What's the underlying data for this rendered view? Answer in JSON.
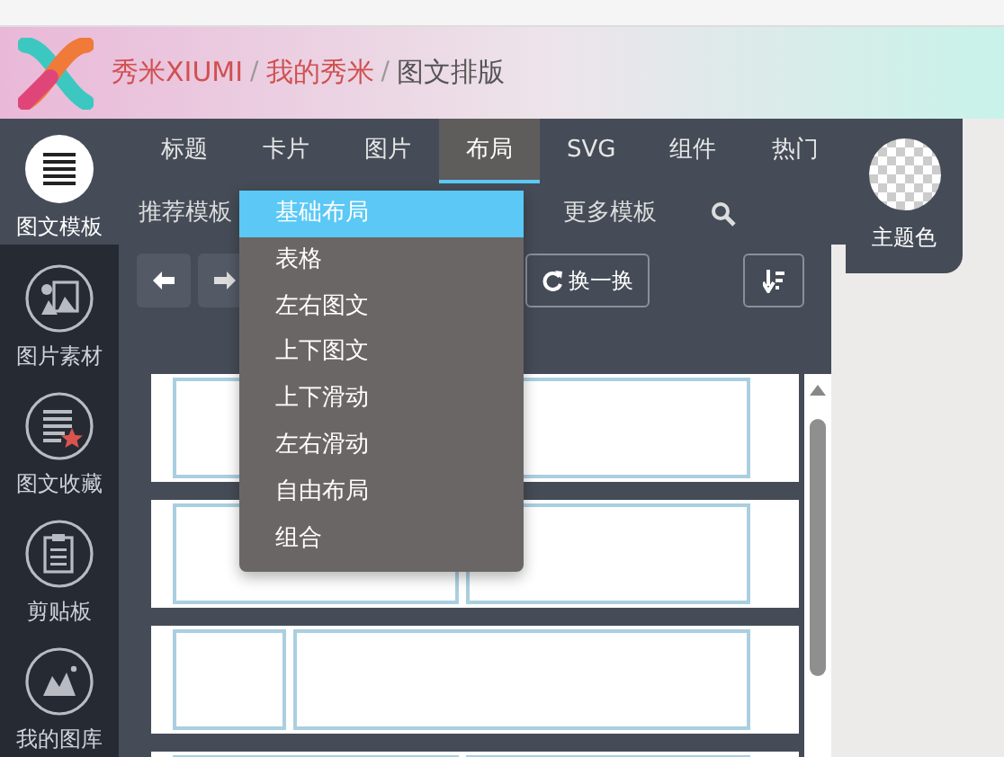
{
  "breadcrumbs": [
    {
      "label": "秀米XIUMI",
      "selected": false,
      "separator": "/"
    },
    {
      "label": "我的秀米",
      "selected": false,
      "separator": "/"
    },
    {
      "label": "图文排版",
      "selected": true
    }
  ],
  "sidebar": {
    "items": [
      {
        "label": "图文模板",
        "selected": true,
        "kind": "lines"
      },
      {
        "label": "图片素材",
        "selected": false,
        "kind": "photos"
      },
      {
        "label": "图文收藏",
        "selected": false,
        "kind": "favorite"
      },
      {
        "label": "剪贴板",
        "selected": false,
        "kind": "clipboard"
      },
      {
        "label": "我的图库",
        "selected": false,
        "kind": "gallery"
      }
    ]
  },
  "tabs": [
    {
      "label": "标题",
      "selected": false
    },
    {
      "label": "卡片",
      "selected": false
    },
    {
      "label": "图片",
      "selected": false
    },
    {
      "label": "布局",
      "selected": true
    },
    {
      "label": "SVG",
      "selected": false
    },
    {
      "label": "组件",
      "selected": false
    },
    {
      "label": "热门",
      "selected": false
    }
  ],
  "subtabs": [
    {
      "label": "推荐模板"
    },
    {
      "label": "更多模板"
    }
  ],
  "theme": {
    "label": "主题色"
  },
  "toolbar": {
    "shuffle_label": "换一换"
  },
  "dropdown": [
    {
      "label": "基础布局",
      "selected": true
    },
    {
      "label": "表格",
      "selected": false
    },
    {
      "label": "左右图文",
      "selected": false
    },
    {
      "label": "上下图文",
      "selected": false
    },
    {
      "label": "上下滑动",
      "selected": false
    },
    {
      "label": "左右滑动",
      "selected": false
    },
    {
      "label": "自由布局",
      "selected": false
    },
    {
      "label": "组合",
      "selected": false
    }
  ],
  "templates": [
    {
      "kind": "single"
    },
    {
      "kind": "halves"
    },
    {
      "kind": "narrow-wide"
    },
    {
      "kind": "halves"
    }
  ]
}
